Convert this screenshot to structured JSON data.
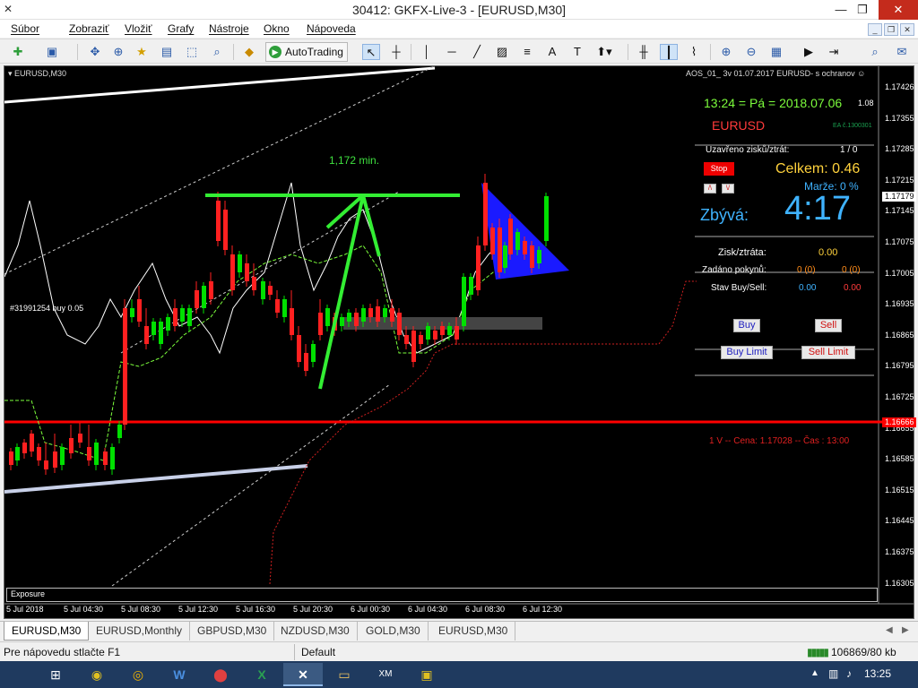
{
  "window": {
    "title": "30412: GKFX-Live-3 - [EURUSD,M30]",
    "app_icon": "x-icon"
  },
  "menu": [
    "Súbor",
    "Zobraziť",
    "Vložiť",
    "Grafy",
    "Nástroje",
    "Okno",
    "Nápoveda"
  ],
  "toolbar": {
    "autotrading_label": "AutoTrading"
  },
  "chart": {
    "symbol_label": "EURUSD,M30",
    "indicator_label": "AOS_01_ 3v 01.07.2017 EURUSD- s ochranov",
    "annotation_min": "1,172 min.",
    "order_label": "#31991254 buy 0.05",
    "exposure_label": "Exposure",
    "current_price_badge": "1.17179",
    "red_line_badge": "1.16666",
    "price_ticks": [
      "1.17426",
      "1.17355",
      "1.17285",
      "1.17215",
      "1.17145",
      "1.17075",
      "1.17005",
      "1.16935",
      "1.16865",
      "1.16795",
      "1.16725",
      "1.16655",
      "1.16585",
      "1.16515",
      "1.16445",
      "1.16375",
      "1.16305"
    ],
    "time_ticks": [
      "5 Jul 2018",
      "5 Jul 04:30",
      "5 Jul 08:30",
      "5 Jul 12:30",
      "5 Jul 16:30",
      "5 Jul 20:30",
      "6 Jul 00:30",
      "6 Jul 04:30",
      "6 Jul 08:30",
      "6 Jul 12:30"
    ],
    "colors": {
      "bull": "#00e000",
      "bear": "#ff2020",
      "red_line": "#ff0000",
      "green_line": "#33ee33",
      "triangle": "#1a1aff"
    }
  },
  "ea": {
    "clock_line": "13:24 = Pá = 2018.07.06",
    "version": "1.08",
    "symbol": "EURUSD",
    "ea_no": "EA č.1300301",
    "closed_label": "Uzavřeno zisků/ztrát:",
    "closed_value": "1 / 0",
    "stop_btn": "Stop",
    "total_label": "Celkem: 0.46",
    "margin_label": "Marže:  0 %",
    "remaining_label": "Zbývá:",
    "remaining_value": "4:17",
    "profit_label": "Zisk/ztráta:",
    "profit_value": "0.00",
    "orders_label": "Zadáno pokynů:",
    "orders_buy": "0 (0)",
    "orders_sell": "0 (0)",
    "state_label": "Stav Buy/Sell:",
    "state_buy": "0.00",
    "state_sell": "0.00",
    "buy_btn": "Buy",
    "sell_btn": "Sell",
    "buy_limit_btn": "Buy Limit",
    "sell_limit_btn": "Sell Limit",
    "signal_line": "1 V -- Cena: 1.17028 -- Čas : 13:00",
    "mini_btn_1": "/\\",
    "mini_btn_2": "\\/"
  },
  "tabs": [
    "EURUSD,M30",
    "EURUSD,Monthly",
    "GBPUSD,M30",
    "NZDUSD,M30",
    "GOLD,M30",
    "EURUSD,M30"
  ],
  "status": {
    "help": "Pre nápovedu stlačte F1",
    "profile": "Default",
    "traffic": "106869/80 kb"
  },
  "taskbar": {
    "clock": "13:25"
  }
}
